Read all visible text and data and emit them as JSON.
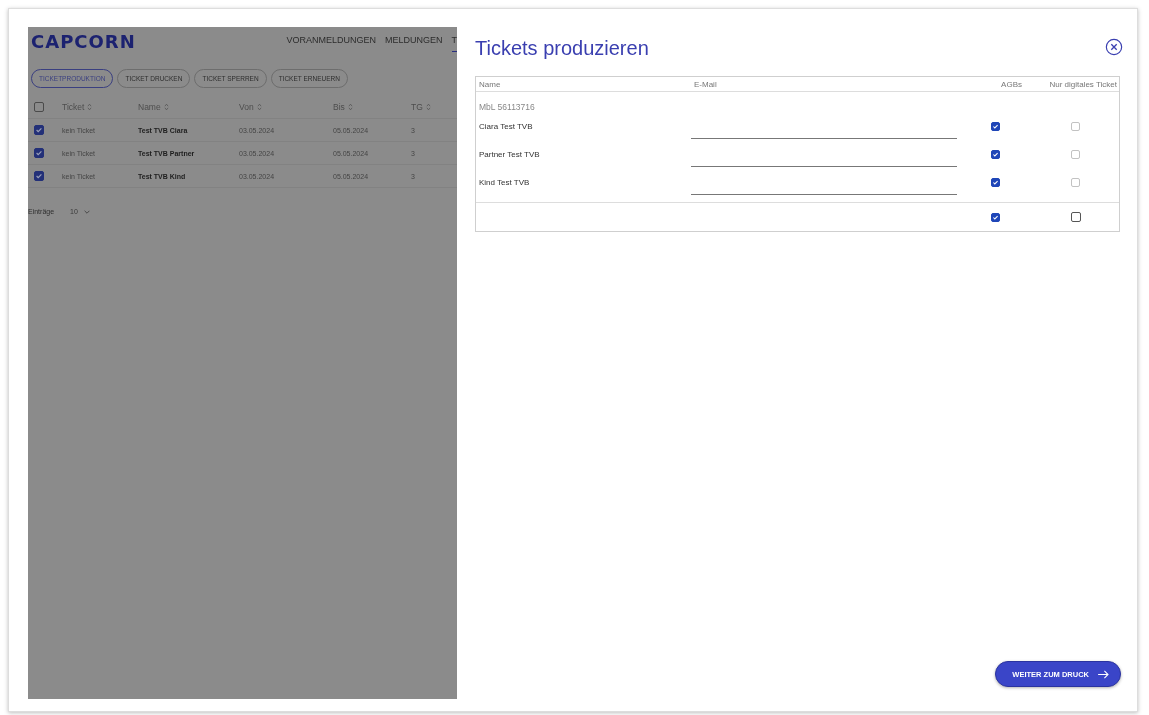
{
  "background_app": {
    "logo": "CAPCORN",
    "nav": [
      {
        "label": "VORANMELDUNGEN",
        "selected": false
      },
      {
        "label": "MELDUNGEN",
        "selected": false
      },
      {
        "label": "T",
        "selected": true
      }
    ],
    "action_buttons": [
      {
        "label": "TICKETPRODUKTION",
        "selected": true
      },
      {
        "label": "TICKET DRUCKEN",
        "selected": false
      },
      {
        "label": "TICKET SPERREN",
        "selected": false
      },
      {
        "label": "TICKET ERNEUERN",
        "selected": false
      }
    ],
    "table": {
      "select_all_checked": false,
      "columns": [
        "Ticket",
        "Name",
        "Von",
        "Bis",
        "TG"
      ],
      "rows": [
        {
          "checked": true,
          "ticket": "kein Ticket",
          "name": "Test TVB Ciara",
          "von": "03.05.2024",
          "bis": "05.05.2024",
          "tg": "3"
        },
        {
          "checked": true,
          "ticket": "kein Ticket",
          "name": "Test TVB Partner",
          "von": "03.05.2024",
          "bis": "05.05.2024",
          "tg": "3"
        },
        {
          "checked": true,
          "ticket": "kein Ticket",
          "name": "Test TVB Kind",
          "von": "03.05.2024",
          "bis": "05.05.2024",
          "tg": "3"
        }
      ]
    },
    "entries": {
      "label": "Einträge",
      "value": "10"
    }
  },
  "dialog": {
    "title": "Tickets produzieren",
    "columns": [
      "Name",
      "E-Mail",
      "AGBs",
      "Nur digitales Ticket"
    ],
    "group_label": "MbL 56113716",
    "rows": [
      {
        "name": "Ciara Test TVB",
        "agb_checked": true,
        "digital_checked": false
      },
      {
        "name": "Partner Test TVB",
        "agb_checked": true,
        "digital_checked": false
      },
      {
        "name": "Kind Test TVB",
        "agb_checked": true,
        "digital_checked": false
      }
    ],
    "footer": {
      "agb_checked": true,
      "digital_checked": false
    },
    "button": "WEITER ZUM DRUCK"
  }
}
